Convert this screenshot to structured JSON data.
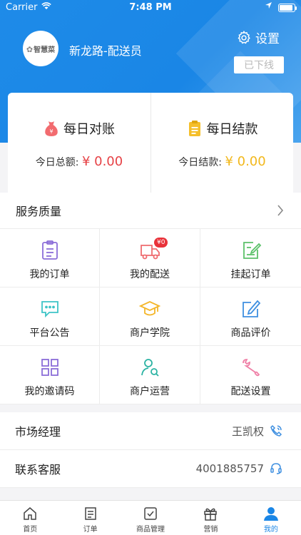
{
  "status_bar": {
    "carrier": "Carrier",
    "time": "7:48 PM"
  },
  "profile": {
    "logo_text": "智慧菜",
    "name": "新龙路-配送员",
    "settings_label": "设置",
    "status_button": "已下线"
  },
  "summary": {
    "daily_reconcile": {
      "title": "每日对账",
      "label": "今日总额:",
      "amount": "¥ 0.00"
    },
    "daily_settlement": {
      "title": "每日结款",
      "label": "今日结款:",
      "amount": "¥ 0.00"
    }
  },
  "services": {
    "title": "服务质量",
    "items": [
      {
        "label": "我的订单",
        "icon": "clipboard-icon"
      },
      {
        "label": "我的配送",
        "icon": "truck-icon",
        "badge": "¥0"
      },
      {
        "label": "挂起订单",
        "icon": "edit-note-icon"
      },
      {
        "label": "平台公告",
        "icon": "chat-bubble-icon"
      },
      {
        "label": "商户学院",
        "icon": "graduation-cap-icon"
      },
      {
        "label": "商品评价",
        "icon": "pencil-square-icon"
      },
      {
        "label": "我的邀请码",
        "icon": "qr-code-icon"
      },
      {
        "label": "商户运营",
        "icon": "person-search-icon"
      },
      {
        "label": "配送设置",
        "icon": "wrench-icon"
      }
    ]
  },
  "contacts": {
    "manager": {
      "label": "市场经理",
      "value": "王凯权"
    },
    "support": {
      "label": "联系客服",
      "value": "4001885757"
    }
  },
  "tabbar": {
    "items": [
      {
        "label": "首页"
      },
      {
        "label": "订单"
      },
      {
        "label": "商品管理"
      },
      {
        "label": "营销"
      },
      {
        "label": "我的"
      }
    ]
  },
  "colors": {
    "primary": "#1a86e6",
    "red_amount": "#e64246",
    "yellow_amount": "#f2b81c"
  }
}
